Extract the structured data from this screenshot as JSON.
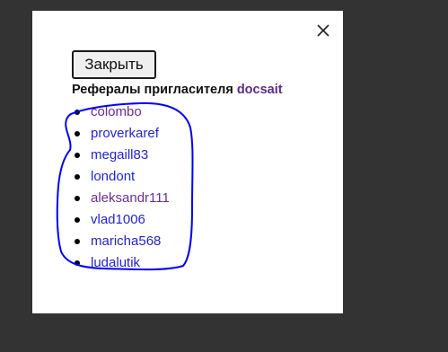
{
  "modal": {
    "close_icon": "close-icon",
    "close_button_label": "Закрыть",
    "title_prefix": "Рефералы пригласителя",
    "title_user": "docsait"
  },
  "referrals": [
    {
      "name": "colombo",
      "color": "#6a2c9c"
    },
    {
      "name": "proverkaref",
      "color": "#2323d8"
    },
    {
      "name": "megaill83",
      "color": "#2323d8"
    },
    {
      "name": "londont",
      "color": "#2323d8"
    },
    {
      "name": "aleksandr111",
      "color": "#6a2c9c"
    },
    {
      "name": "vlad1006",
      "color": "#2323d8"
    },
    {
      "name": "maricha568",
      "color": "#2323d8"
    },
    {
      "name": "ludalutik",
      "color": "#2323d8"
    }
  ],
  "colors": {
    "backdrop": "#333333",
    "visited_link": "#6a2c9c",
    "link": "#2323d8",
    "annotation_stroke": "#0000ff"
  }
}
